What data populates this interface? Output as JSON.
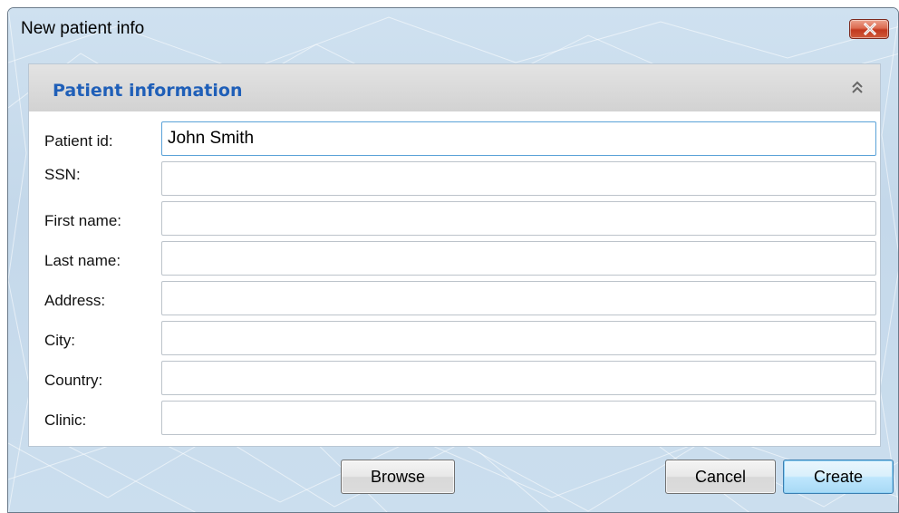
{
  "window": {
    "title": "New patient info",
    "close_icon": "close-icon"
  },
  "panel": {
    "title": "Patient information",
    "collapse_icon": "double-chevron-up-icon"
  },
  "fields": [
    {
      "label": "Patient id:",
      "value": "John Smith"
    },
    {
      "label": "SSN:",
      "value": ""
    },
    {
      "label": "First name:",
      "value": ""
    },
    {
      "label": "Last name:",
      "value": ""
    },
    {
      "label": "Address:",
      "value": ""
    },
    {
      "label": "City:",
      "value": ""
    },
    {
      "label": "Country:",
      "value": ""
    },
    {
      "label": "Clinic:",
      "value": ""
    }
  ],
  "buttons": {
    "browse": "Browse",
    "cancel": "Cancel",
    "create": "Create"
  },
  "colors": {
    "panel_title": "#1f5fb8",
    "close_button": "#c2391f",
    "focused_border": "#5aa2d8"
  }
}
